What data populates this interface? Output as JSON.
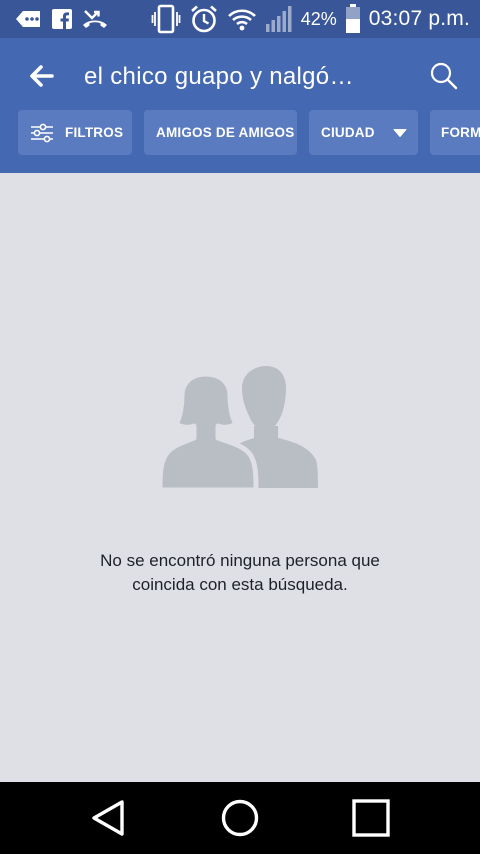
{
  "status_bar": {
    "battery_percent": "42%",
    "time": "03:07 p.m.",
    "icons": [
      "messages-icon",
      "facebook-icon",
      "missed-call-icon",
      "vibrate-icon",
      "alarm-icon",
      "wifi-icon",
      "signal-icon",
      "battery-icon"
    ]
  },
  "header": {
    "search_query": "el chico guapo y nalgó…",
    "back_icon": "back-arrow-icon",
    "search_icon": "search-icon",
    "background_color": "#4568b2"
  },
  "filters": {
    "filtros_label": "FILTROS",
    "amigos_label": "AMIGOS DE AMIGOS",
    "ciudad_label": "CIUDAD",
    "formacion_label": "FORM"
  },
  "empty_state": {
    "illustration": "people-silhouette-icon",
    "message_line1": "No se encontró ninguna persona que",
    "message_line2": "coincida con esta búsqueda."
  },
  "nav_bar": {
    "buttons": [
      "back-triangle-icon",
      "home-circle-icon",
      "recents-square-icon"
    ]
  }
}
